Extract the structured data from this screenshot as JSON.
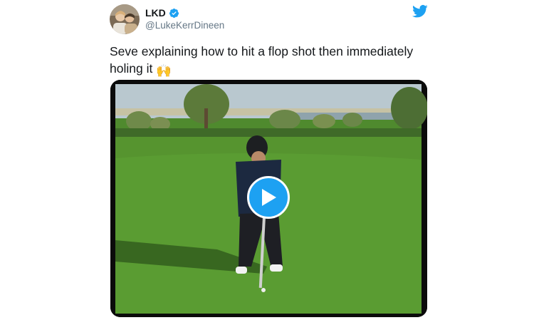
{
  "tweet": {
    "author": {
      "name": "LKD",
      "handle": "@LukeKerrDineen",
      "verified": true
    },
    "text": "Seve explaining how to hit a flop shot then immediately holing it",
    "emoji": "🙌",
    "media": {
      "type": "video"
    }
  },
  "colors": {
    "twitter_blue": "#1da1f2",
    "text_primary": "#14171a",
    "text_secondary": "#657786"
  },
  "icons": {
    "logo": "twitter-bird-icon",
    "verified": "verified-badge-icon",
    "play": "play-icon"
  }
}
